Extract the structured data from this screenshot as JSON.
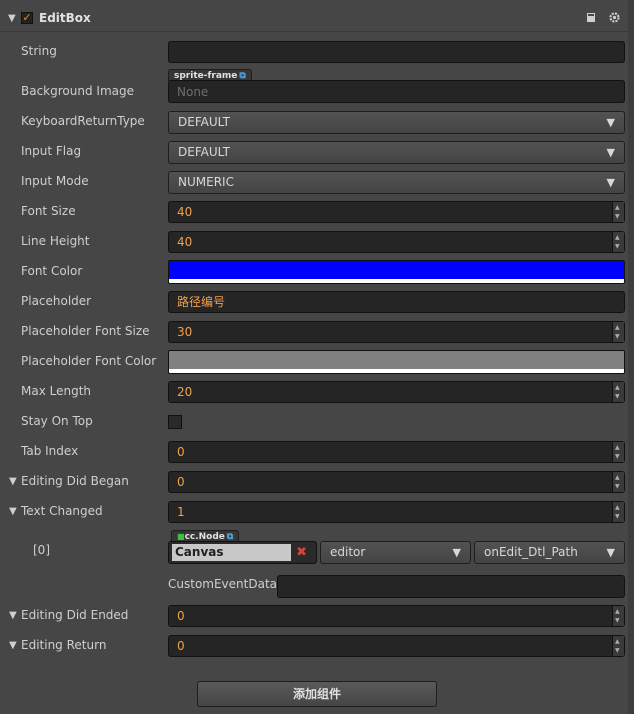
{
  "component": {
    "title": "EditBox",
    "enabled": true,
    "help_icon": "book-icon",
    "settings_icon": "gear-icon"
  },
  "props": {
    "string": {
      "label": "String",
      "value": ""
    },
    "background_image": {
      "label": "Background Image",
      "tag": "sprite-frame",
      "value": "None"
    },
    "keyboard_return_type": {
      "label": "KeyboardReturnType",
      "value": "DEFAULT"
    },
    "input_flag": {
      "label": "Input Flag",
      "value": "DEFAULT"
    },
    "input_mode": {
      "label": "Input Mode",
      "value": "NUMERIC"
    },
    "font_size": {
      "label": "Font Size",
      "value": "40"
    },
    "line_height": {
      "label": "Line Height",
      "value": "40"
    },
    "font_color": {
      "label": "Font Color",
      "color": "#0000ff"
    },
    "placeholder": {
      "label": "Placeholder",
      "value": "路径编号"
    },
    "placeholder_font_size": {
      "label": "Placeholder Font Size",
      "value": "30"
    },
    "placeholder_font_color": {
      "label": "Placeholder Font Color",
      "color": "#808080"
    },
    "max_length": {
      "label": "Max Length",
      "value": "20"
    },
    "stay_on_top": {
      "label": "Stay On Top",
      "checked": false
    },
    "tab_index": {
      "label": "Tab Index",
      "value": "0"
    },
    "editing_did_began": {
      "label": "Editing Did Began",
      "value": "0"
    },
    "text_changed": {
      "label": "Text Changed",
      "value": "1"
    },
    "event_item": {
      "index_label": "[0]",
      "target_tag": "cc.Node",
      "target_value": "Canvas",
      "component_value": "editor",
      "handler_value": "onEdit_Dtl_Path",
      "custom_event_data_label": "CustomEventData",
      "custom_event_data_value": ""
    },
    "editing_did_ended": {
      "label": "Editing Did Ended",
      "value": "0"
    },
    "editing_return": {
      "label": "Editing Return",
      "value": "0"
    }
  },
  "footer": {
    "add_component_label": "添加组件"
  },
  "colors": {
    "background": "#464646",
    "field": "#252525",
    "number_text": "#f0a04b",
    "accent_check": "#f08a1c"
  }
}
